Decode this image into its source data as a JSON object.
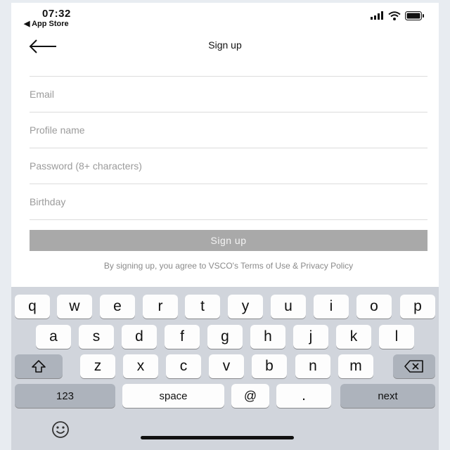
{
  "status_bar": {
    "time": "07:32",
    "back_to_app": "◀ App Store"
  },
  "nav": {
    "title": "Sign up"
  },
  "form": {
    "email_placeholder": "Email",
    "profile_name_placeholder": "Profile name",
    "password_placeholder": "Password (8+ characters)",
    "birthday_placeholder": "Birthday",
    "submit_label": "Sign up",
    "terms_text": "By signing up, you agree to VSCO's Terms of Use & Privacy Policy"
  },
  "keyboard": {
    "row1": [
      "q",
      "w",
      "e",
      "r",
      "t",
      "y",
      "u",
      "i",
      "o",
      "p"
    ],
    "row2": [
      "a",
      "s",
      "d",
      "f",
      "g",
      "h",
      "j",
      "k",
      "l"
    ],
    "row3": [
      "z",
      "x",
      "c",
      "v",
      "b",
      "n",
      "m"
    ],
    "numbers_label": "123",
    "space_label": "space",
    "at_label": "@",
    "dot_label": ".",
    "next_label": "next"
  },
  "colors": {
    "button_disabled": "#a9a9a9",
    "keyboard_bg": "#d1d5dc"
  }
}
